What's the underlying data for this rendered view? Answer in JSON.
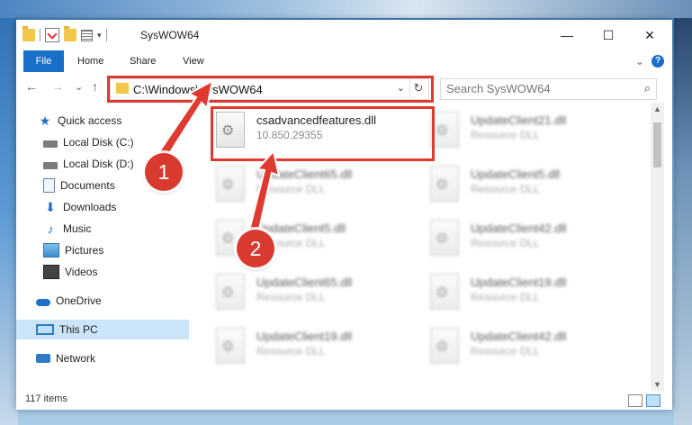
{
  "window": {
    "title": "SysWOW64",
    "controls": {
      "minimize": "—",
      "maximize": "☐",
      "close": "✕"
    }
  },
  "ribbon": {
    "tabs": [
      "File",
      "Home",
      "Share",
      "View"
    ],
    "expand_icon": "⌄",
    "help_icon": "?"
  },
  "navigation": {
    "back": "←",
    "forward": "→",
    "recent": "⌄",
    "up": "↑"
  },
  "address_bar": {
    "path": "C:\\Windows\\SysWOW64",
    "dropdown": "⌄",
    "refresh": "↻"
  },
  "search": {
    "placeholder": "Search SysWOW64",
    "icon": "search-icon"
  },
  "sidebar": {
    "items": [
      {
        "label": "Quick access",
        "icon": "star-icon",
        "pinned": false
      },
      {
        "label": "Local Disk (C:)",
        "icon": "disk-icon",
        "pinned": false
      },
      {
        "label": "Local Disk (D:)",
        "icon": "disk-icon",
        "pinned": false
      },
      {
        "label": "Documents",
        "icon": "documents-icon",
        "pinned": true
      },
      {
        "label": "Downloads",
        "icon": "downloads-icon",
        "pinned": true
      },
      {
        "label": "Music",
        "icon": "music-icon",
        "pinned": true
      },
      {
        "label": "Pictures",
        "icon": "pictures-icon",
        "pinned": true
      },
      {
        "label": "Videos",
        "icon": "videos-icon",
        "pinned": true
      },
      {
        "label": "OneDrive",
        "icon": "onedrive-icon",
        "pinned": false
      },
      {
        "label": "This PC",
        "icon": "pc-icon",
        "pinned": false,
        "selected": true
      },
      {
        "label": "Network",
        "icon": "network-icon",
        "pinned": false
      }
    ]
  },
  "files": [
    {
      "name": "csadvancedfeatures.dll",
      "detail": "10.850.29355"
    },
    {
      "name": "UpdateClient21.dll",
      "detail": "Resource DLL"
    },
    {
      "name": "UpdateClient65.dll",
      "detail": "Resource DLL"
    },
    {
      "name": "UpdateClient5.dll",
      "detail": "Resource DLL"
    },
    {
      "name": "UpdateClient5.dll",
      "detail": "Resource DLL"
    },
    {
      "name": "UpdateClient42.dll",
      "detail": "Resource DLL"
    },
    {
      "name": "UpdateClient65.dll",
      "detail": "Resource DLL"
    },
    {
      "name": "UpdateClient19.dll",
      "detail": "Resource DLL"
    },
    {
      "name": "UpdateClient19.dll",
      "detail": "Resource DLL"
    },
    {
      "name": "UpdateClient42.dll",
      "detail": "Resource DLL"
    }
  ],
  "status": {
    "item_count": "117 items"
  },
  "annotations": {
    "step1": "1",
    "step2": "2",
    "color": "#e0392f"
  }
}
